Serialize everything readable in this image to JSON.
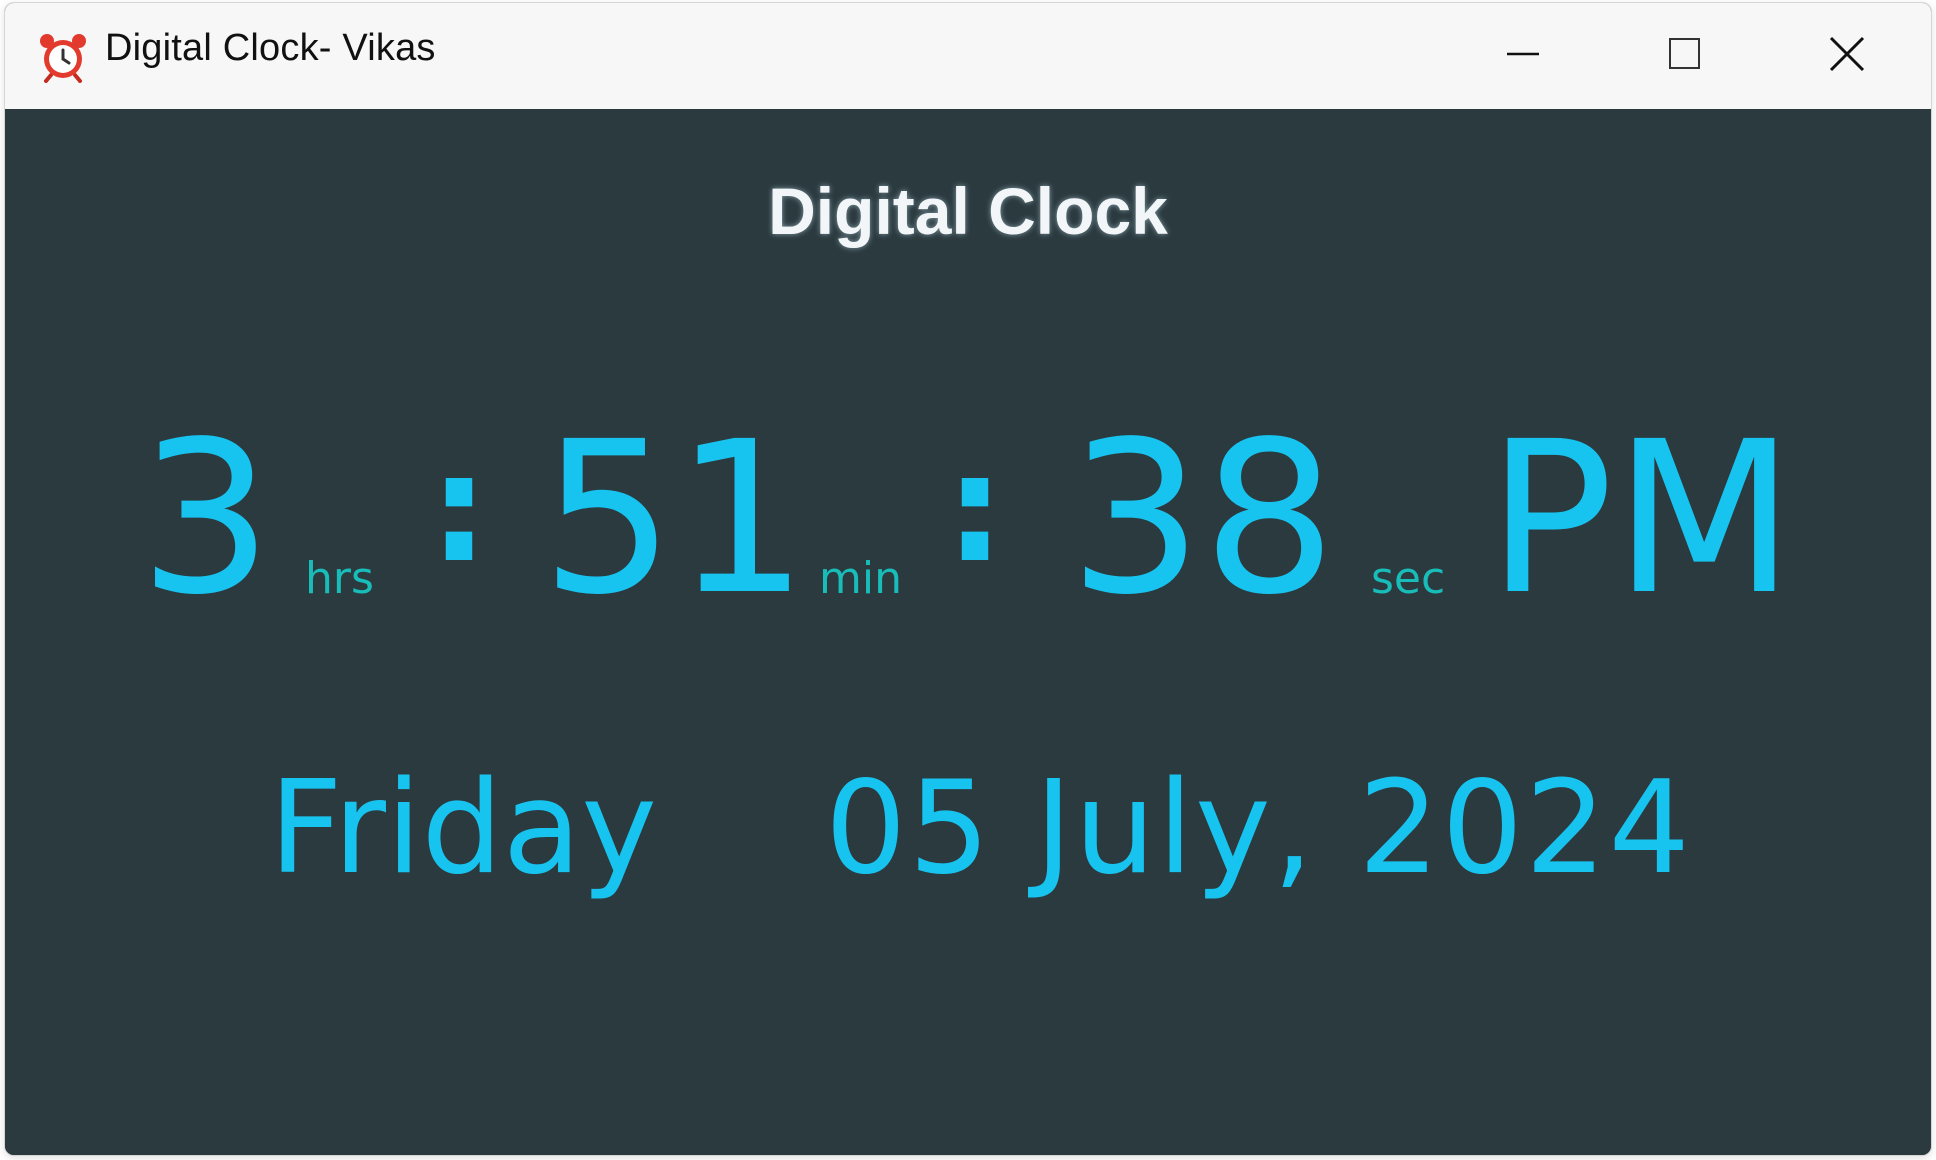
{
  "window": {
    "title": "Digital Clock- Vikas",
    "icon": "alarm-clock-icon"
  },
  "controls": {
    "minimize_icon": "minimize-icon",
    "maximize_icon": "maximize-icon",
    "close_icon": "close-icon"
  },
  "clock": {
    "heading": "Digital Clock",
    "hours": "3",
    "hours_unit": "hrs",
    "separator": ":",
    "minutes": "51",
    "minutes_unit": "min",
    "seconds": "38",
    "seconds_unit": "sec",
    "meridiem": "PM",
    "day": "Friday",
    "date": "05 July, 2024"
  },
  "colors": {
    "background": "#2b3a3f",
    "digits": "#17c4f0",
    "units": "#18bcb8",
    "heading": "#f2f6f8",
    "titlebar": "#f7f7f7"
  }
}
